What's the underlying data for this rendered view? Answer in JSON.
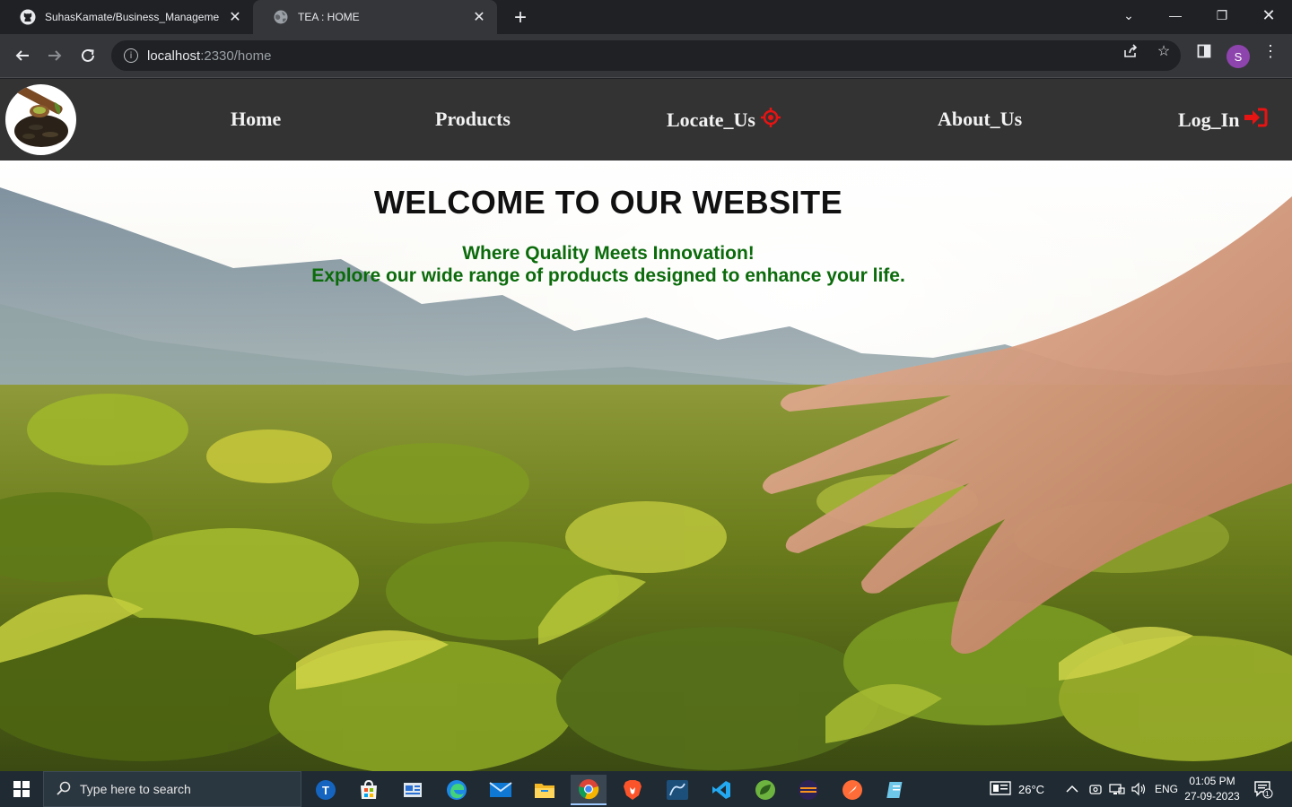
{
  "browser": {
    "tabs": [
      {
        "title": "SuhasKamate/Business_Manageme",
        "icon": "github-icon",
        "active": false
      },
      {
        "title": "TEA : HOME",
        "icon": "globe-icon",
        "active": true
      }
    ],
    "address": {
      "host": "localhost",
      "path": ":2330/home"
    },
    "profile_initial": "S"
  },
  "site": {
    "nav": {
      "home": "Home",
      "products": "Products",
      "locate": "Locate_Us",
      "about": "About_Us",
      "login": "Log_In"
    },
    "hero": {
      "title": "WELCOME TO OUR WEBSITE",
      "line1": "Where Quality Meets Innovation!",
      "line2": "Explore our wide range of products designed to enhance your life."
    },
    "colors": {
      "nav_bg": "#333333",
      "accent_icon": "#e81313",
      "subtitle": "#0b6b0b"
    }
  },
  "taskbar": {
    "search_placeholder": "Type here to search",
    "weather": "26°C",
    "language": "ENG",
    "time": "01:05 PM",
    "date": "27-09-2023",
    "notification_count": "1"
  }
}
